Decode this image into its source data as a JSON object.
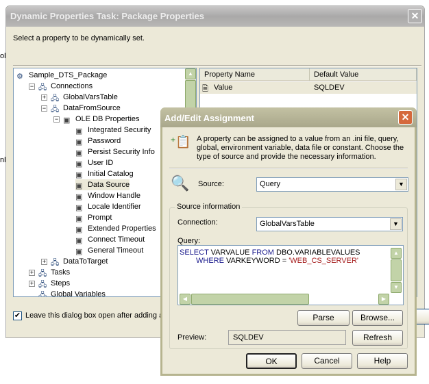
{
  "background_fragments": [
    "ol",
    "nl"
  ],
  "outer_dialog": {
    "title": "Dynamic Properties Task: Package Properties",
    "prompt": "Select a property to be dynamically set.",
    "tree": [
      {
        "label": "Sample_DTS_Package",
        "level": 0
      },
      {
        "label": "Connections",
        "level": 1,
        "expander": "−"
      },
      {
        "label": "GlobalVarsTable",
        "level": 2,
        "expander": "+"
      },
      {
        "label": "DataFromSource",
        "level": 2,
        "expander": "−"
      },
      {
        "label": "OLE DB Properties",
        "level": 3,
        "expander": "−"
      },
      {
        "label": "Integrated Security",
        "level": 4
      },
      {
        "label": "Password",
        "level": 4
      },
      {
        "label": "Persist Security Info",
        "level": 4
      },
      {
        "label": "User ID",
        "level": 4
      },
      {
        "label": "Initial Catalog",
        "level": 4
      },
      {
        "label": "Data Source",
        "level": 4,
        "selected": true
      },
      {
        "label": "Window Handle",
        "level": 4
      },
      {
        "label": "Locale Identifier",
        "level": 4
      },
      {
        "label": "Prompt",
        "level": 4
      },
      {
        "label": "Extended Properties",
        "level": 4
      },
      {
        "label": "Connect Timeout",
        "level": 4
      },
      {
        "label": "General Timeout",
        "level": 4
      },
      {
        "label": "DataToTarget",
        "level": 2,
        "expander": "+"
      },
      {
        "label": "Tasks",
        "level": 1,
        "expander": "+"
      },
      {
        "label": "Steps",
        "level": 1,
        "expander": "+"
      },
      {
        "label": "Global Variables",
        "level": 1
      }
    ],
    "list": {
      "columns": [
        "Property Name",
        "Default Value"
      ],
      "rows": [
        [
          "Value",
          "SQLDEV"
        ]
      ]
    },
    "checkbox_label": "Leave this dialog box open after adding a",
    "checkbox_checked": true
  },
  "inner_dialog": {
    "title": "Add/Edit Assignment",
    "description": "A property can be assigned to a value from an .ini file, query, global, environment variable, data file or constant.  Choose the type of source and provide the necessary information.",
    "source_label": "Source:",
    "source_value": "Query",
    "group_label": "Source information",
    "connection_label": "Connection:",
    "connection_value": "GlobalVarsTable",
    "query_label": "Query:",
    "query": {
      "l1a": "SELECT",
      "l1b": " VARVALUE ",
      "l1c": "FROM",
      "l1d": " DBO.VARIABLEVALUES",
      "l2a": "WHERE",
      "l2b": " VARKEYWORD = ",
      "l2c": "'WEB_CS_SERVER'"
    },
    "parse": "Parse",
    "browse": "Browse...",
    "preview_label": "Preview:",
    "preview_value": "SQLDEV",
    "refresh": "Refresh",
    "ok": "OK",
    "cancel": "Cancel",
    "help": "Help"
  }
}
